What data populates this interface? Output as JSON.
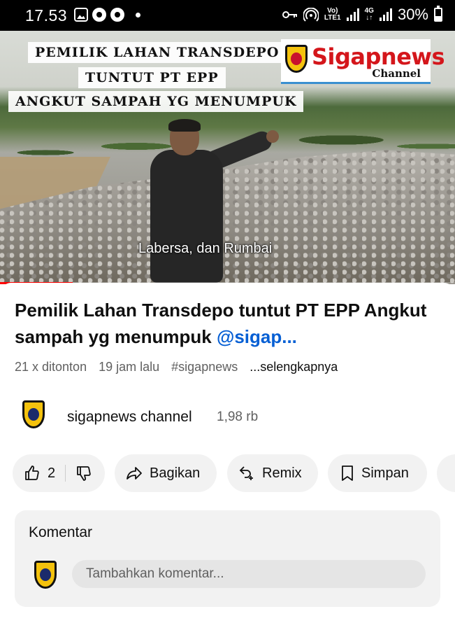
{
  "status_bar": {
    "time": "17.53",
    "network_top": "Vo)",
    "network_bottom": "LTE1",
    "net_type_top": "4G",
    "net_type_bottom": "↓↑",
    "battery": "30%"
  },
  "video": {
    "overlay_line1": "PEMILIK LAHAN TRANSDEPO",
    "overlay_line2": "TUNTUT PT EPP",
    "overlay_line3": "ANGKUT SAMPAH YG MENUMPUK",
    "logo_text": "Sigapnews",
    "logo_sub": "Channel",
    "caption": "Labersa, dan Rumbai",
    "progress_fraction": 0.16
  },
  "info": {
    "title": "Pemilik Lahan Transdepo tuntut PT EPP Angkut sampah yg menumpuk",
    "title_tag": "@sigap...",
    "views": "21 x ditonton",
    "time_ago": "19 jam lalu",
    "hashtag": "#sigapnews",
    "more": "...selengkapnya"
  },
  "channel": {
    "name": "sigapnews channel",
    "subscribers": "1,98 rb"
  },
  "actions": {
    "like_count": "2",
    "share_label": "Bagikan",
    "remix_label": "Remix",
    "save_label": "Simpan"
  },
  "comments": {
    "title": "Komentar",
    "placeholder": "Tambahkan komentar..."
  },
  "colors": {
    "accent_link": "#065fd4",
    "progress": "#ff0000",
    "pill_bg": "#f2f2f2"
  }
}
